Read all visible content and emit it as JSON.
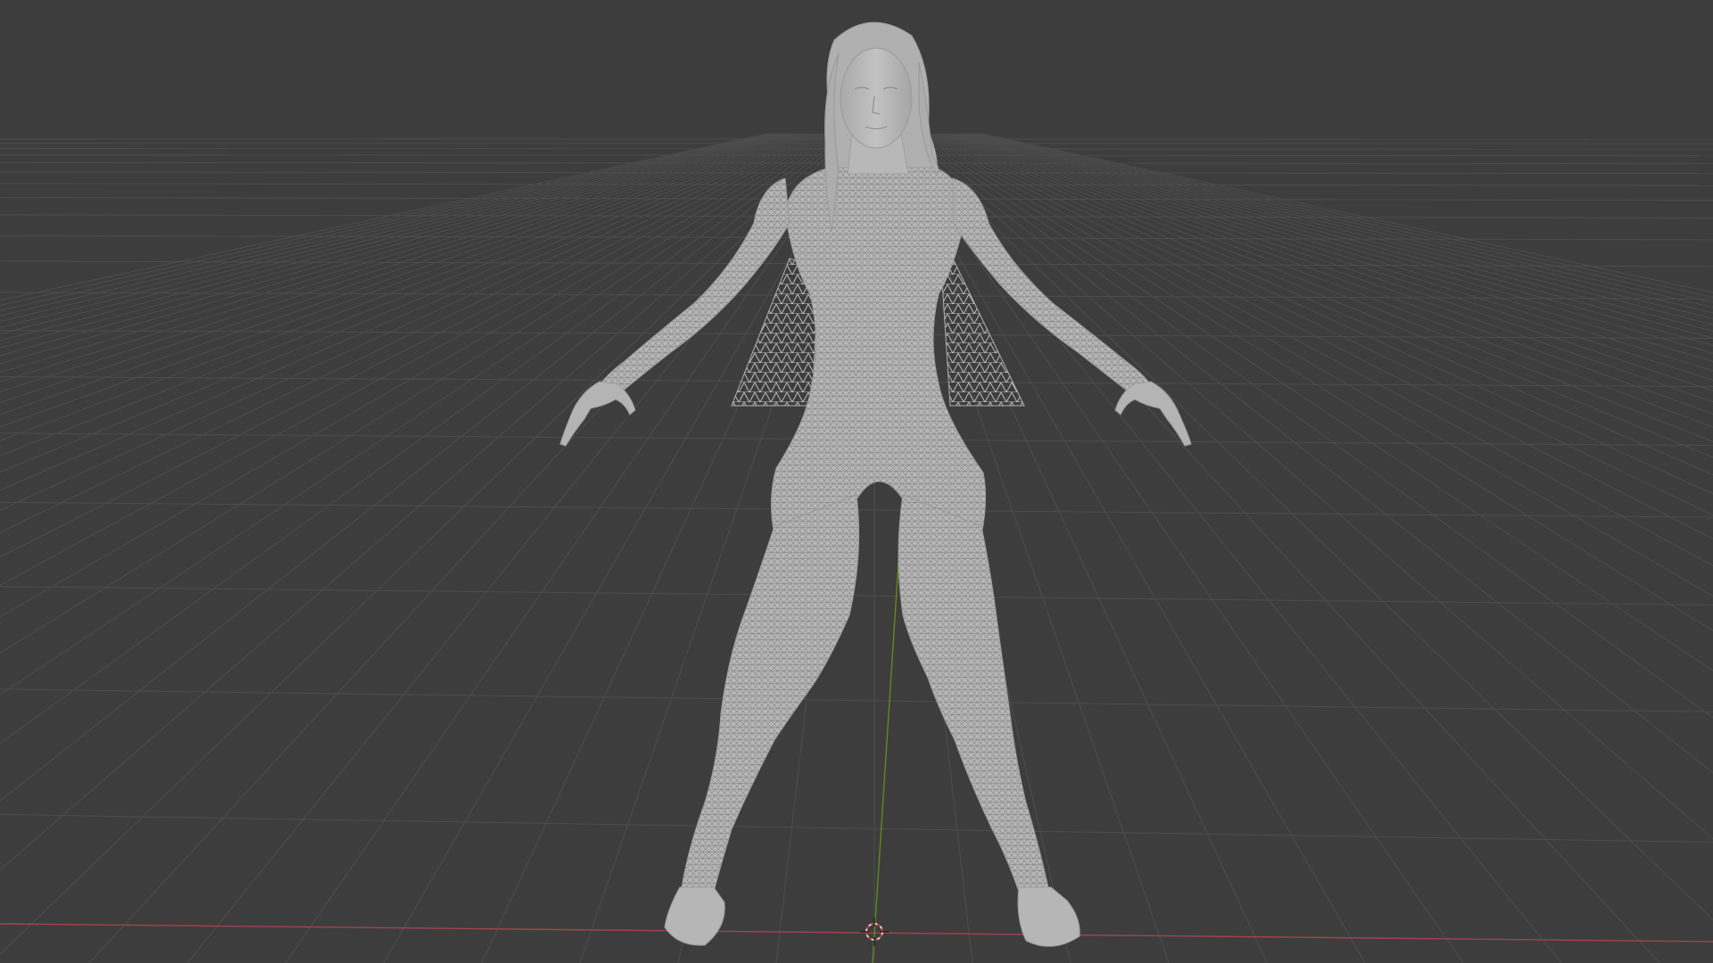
{
  "viewport": {
    "background_color": "#3d3d3d",
    "grid_color": "#4d4d4d",
    "x_axis_color": "#a3434f",
    "y_axis_color": "#5e8a1f",
    "mesh_color": "#b6b6b6",
    "mesh_wire_color": "#9a9a9a",
    "shading_mode": "wireframe-overlay",
    "view": "front-perspective"
  },
  "scene": {
    "objects": [
      {
        "name": "character-mesh",
        "icon": "female-figure-mesh"
      },
      {
        "name": "cape-mesh",
        "icon": "triangulated-cloth"
      },
      {
        "name": "3d-cursor",
        "icon": "crosshair-cursor-icon"
      }
    ]
  }
}
